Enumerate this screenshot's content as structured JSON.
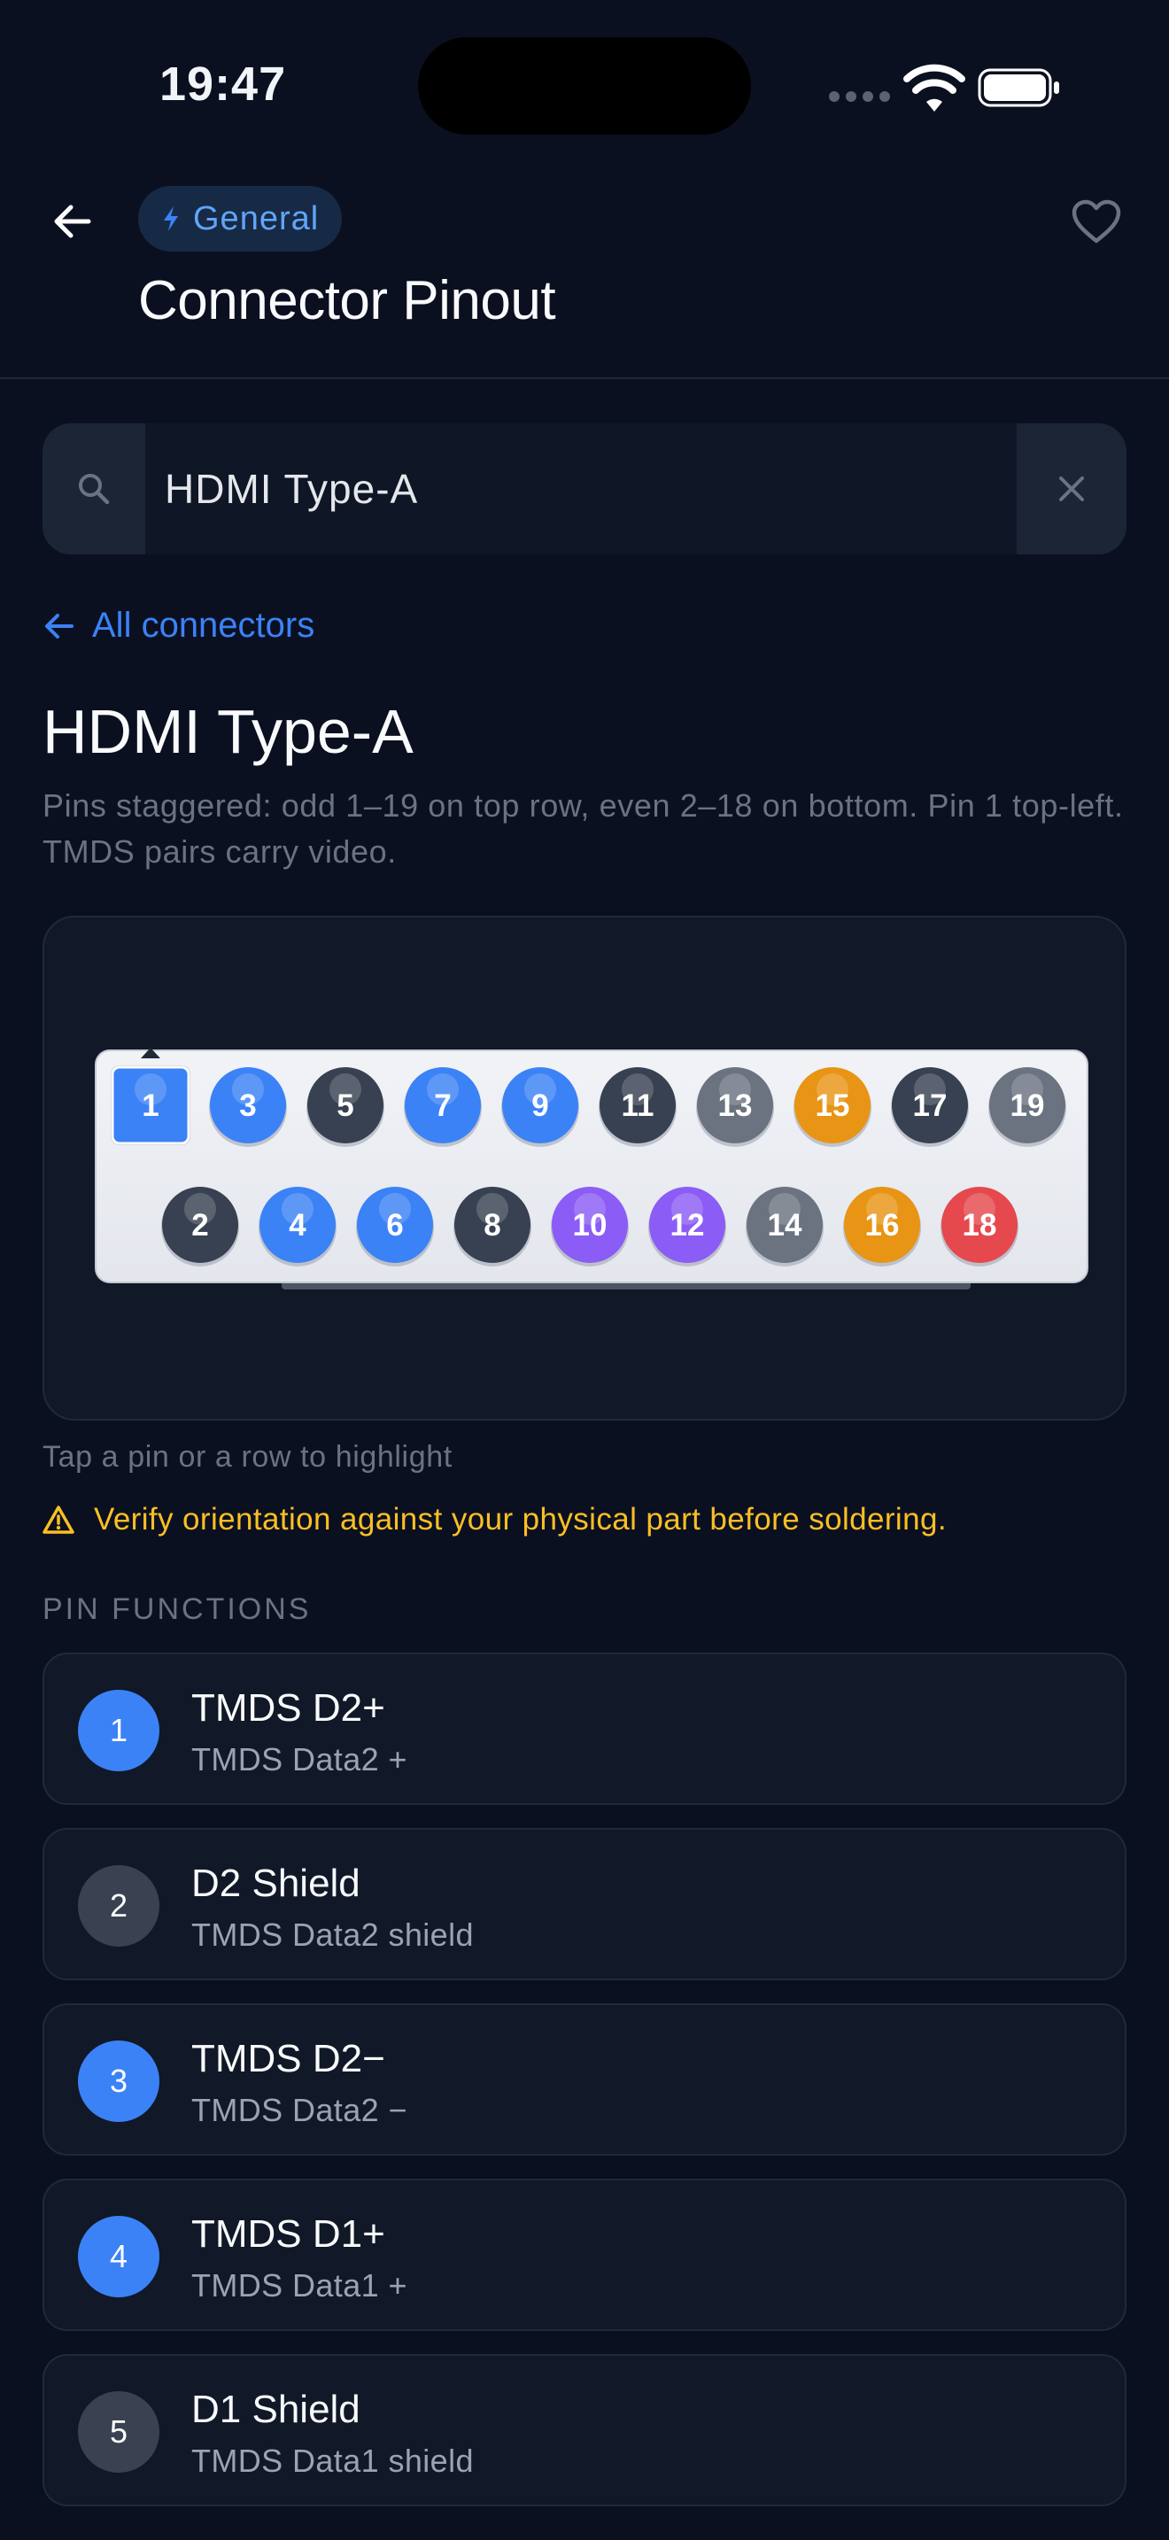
{
  "status_bar": {
    "time": "19:47"
  },
  "header": {
    "category": "General",
    "title": "Connector Pinout"
  },
  "search": {
    "value": "HDMI Type-A",
    "placeholder": ""
  },
  "back_link": {
    "label": "All connectors"
  },
  "connector": {
    "title": "HDMI Type-A",
    "description": "Pins staggered: odd 1–19 on top row, even 2–18 on bottom. Pin 1 top-left. TMDS pairs carry video.",
    "selected_pin": "1",
    "top_row": [
      {
        "pin": "1",
        "color": "#3b82f6"
      },
      {
        "pin": "3",
        "color": "#3b82f6"
      },
      {
        "pin": "5",
        "color": "#374151"
      },
      {
        "pin": "7",
        "color": "#3b82f6"
      },
      {
        "pin": "9",
        "color": "#3b82f6"
      },
      {
        "pin": "11",
        "color": "#374151"
      },
      {
        "pin": "13",
        "color": "#6b7280"
      },
      {
        "pin": "15",
        "color": "#e89414"
      },
      {
        "pin": "17",
        "color": "#374151"
      },
      {
        "pin": "19",
        "color": "#6b7280"
      }
    ],
    "bottom_row": [
      {
        "pin": "2",
        "color": "#374151"
      },
      {
        "pin": "4",
        "color": "#3b82f6"
      },
      {
        "pin": "6",
        "color": "#3b82f6"
      },
      {
        "pin": "8",
        "color": "#374151"
      },
      {
        "pin": "10",
        "color": "#8b5cf6"
      },
      {
        "pin": "12",
        "color": "#8b5cf6"
      },
      {
        "pin": "14",
        "color": "#6b7280"
      },
      {
        "pin": "16",
        "color": "#e89414"
      },
      {
        "pin": "18",
        "color": "#e5484d"
      }
    ]
  },
  "hint": "Tap a pin or a row to highlight",
  "warning": "Verify orientation against your physical part before soldering.",
  "section_label": "PIN FUNCTIONS",
  "pins": [
    {
      "number": "1",
      "name": "TMDS D2+",
      "desc": "TMDS Data2 +",
      "color": "#3b82f6"
    },
    {
      "number": "2",
      "name": "D2 Shield",
      "desc": "TMDS Data2 shield",
      "color": "#3a4150"
    },
    {
      "number": "3",
      "name": "TMDS D2−",
      "desc": "TMDS Data2 −",
      "color": "#3b82f6"
    },
    {
      "number": "4",
      "name": "TMDS D1+",
      "desc": "TMDS Data1 +",
      "color": "#3b82f6"
    },
    {
      "number": "5",
      "name": "D1 Shield",
      "desc": "TMDS Data1 shield",
      "color": "#3a4150"
    }
  ],
  "colors": {
    "accent": "#3b82f6",
    "warning": "#fbbf24",
    "background": "#0b1020"
  },
  "icons": {
    "back": "arrow-left-icon",
    "category": "bolt-icon",
    "favorite": "heart-icon",
    "search": "search-icon",
    "clear": "close-icon",
    "warning": "warning-triangle-icon"
  }
}
